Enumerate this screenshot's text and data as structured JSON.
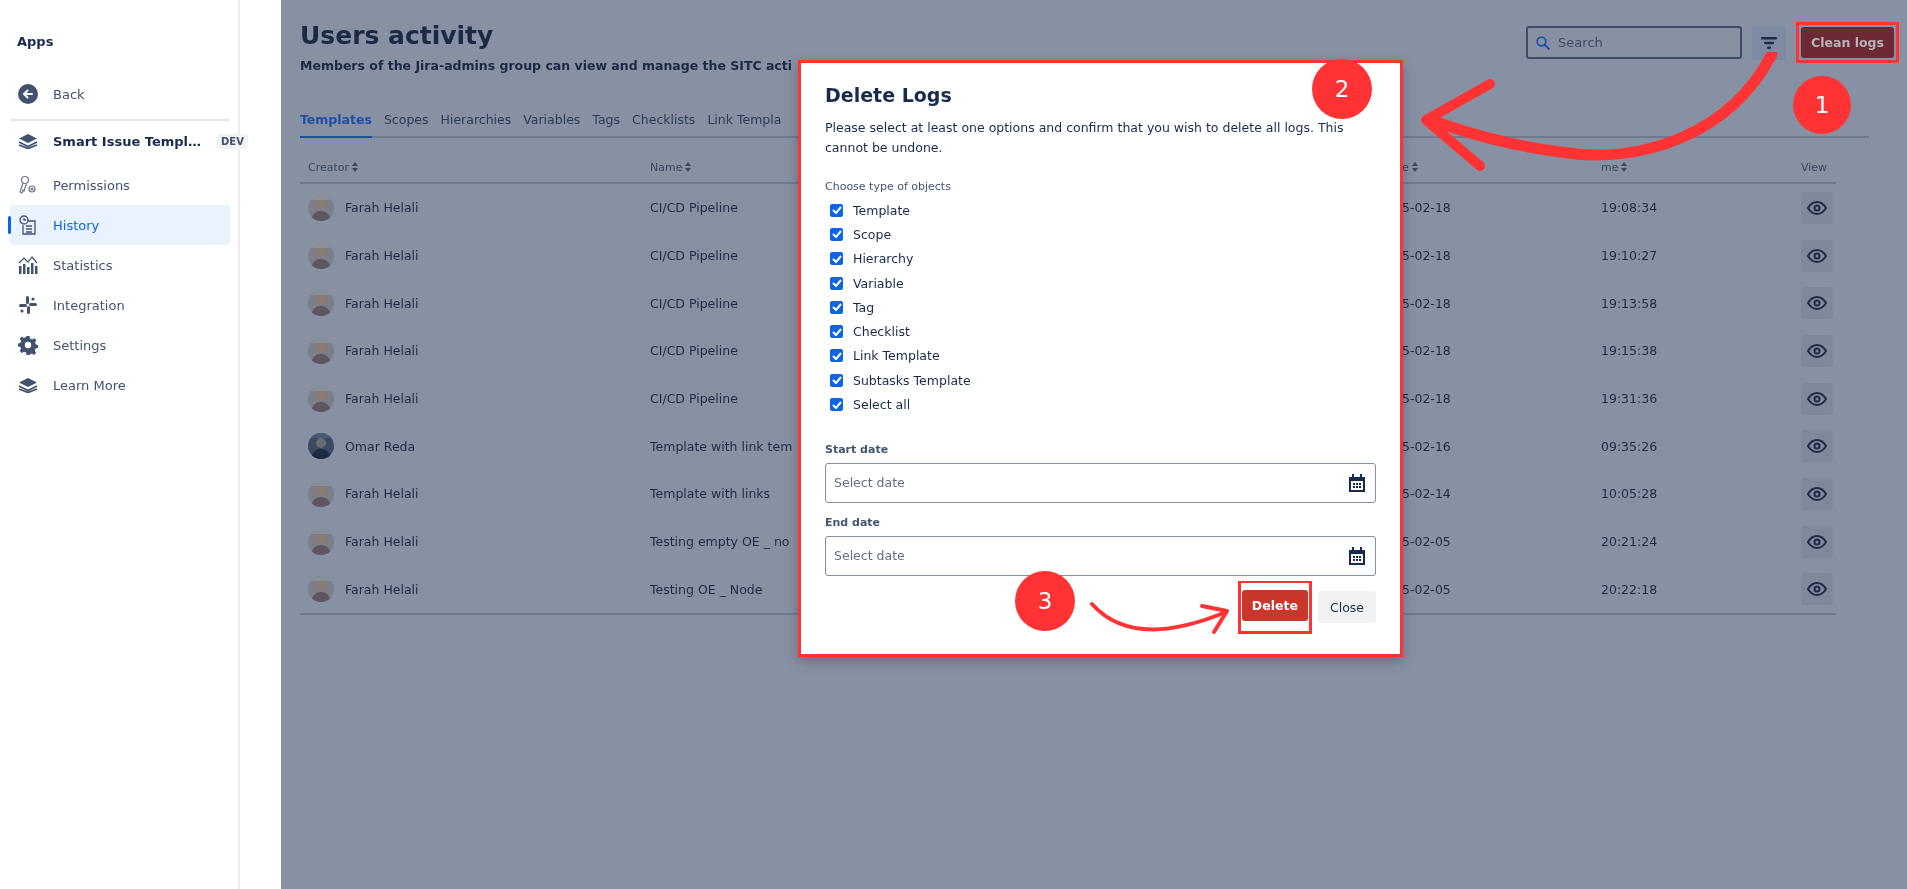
{
  "sidebar": {
    "heading": "Apps",
    "back": "Back",
    "app": {
      "name": "Smart Issue Templ…",
      "badge": "DEV"
    },
    "items": [
      {
        "label": "Permissions",
        "selected": false
      },
      {
        "label": "History",
        "selected": true
      },
      {
        "label": "Statistics",
        "selected": false
      },
      {
        "label": "Integration",
        "selected": false
      },
      {
        "label": "Settings",
        "selected": false
      },
      {
        "label": "Learn More",
        "selected": false
      }
    ]
  },
  "header": {
    "title": "Users activity",
    "subtitle": "Members of the Jira-admins group can view and manage the SITC acti",
    "search": {
      "placeholder": "Search"
    },
    "clean_button": {
      "label": "Clean logs",
      "highlighted": true
    }
  },
  "tabs": [
    {
      "label": "Templates",
      "selected": true
    },
    {
      "label": "Scopes",
      "selected": false
    },
    {
      "label": "Hierarchies",
      "selected": false
    },
    {
      "label": "Variables",
      "selected": false
    },
    {
      "label": "Tags",
      "selected": false
    },
    {
      "label": "Checklists",
      "selected": false
    },
    {
      "label": "Link Templa",
      "selected": false
    }
  ],
  "table": {
    "columns": [
      {
        "label": "Creator",
        "sortable": true
      },
      {
        "label": "Name",
        "sortable": true
      },
      {
        "label": "e",
        "sortable": true
      },
      {
        "label": "me",
        "sortable": true
      },
      {
        "label": "View",
        "sortable": false
      }
    ],
    "rows": [
      {
        "creator": "Farah Helali",
        "name": "CI/CD Pipeline",
        "date": "5-02-18",
        "time": "19:08:34"
      },
      {
        "creator": "Farah Helali",
        "name": "CI/CD Pipeline",
        "date": "5-02-18",
        "time": "19:10:27"
      },
      {
        "creator": "Farah Helali",
        "name": "CI/CD Pipeline",
        "date": "5-02-18",
        "time": "19:13:58"
      },
      {
        "creator": "Farah Helali",
        "name": "CI/CD Pipeline",
        "date": "5-02-18",
        "time": "19:15:38"
      },
      {
        "creator": "Farah Helali",
        "name": "CI/CD Pipeline",
        "date": "5-02-18",
        "time": "19:31:36"
      },
      {
        "creator": "Omar Reda",
        "name": "Template with link tem",
        "date": "5-02-16",
        "time": "09:35:26"
      },
      {
        "creator": "Farah Helali",
        "name": "Template with links",
        "date": "5-02-14",
        "time": "10:05:28"
      },
      {
        "creator": "Farah Helali",
        "name": "Testing empty OE _ no",
        "date": "5-02-05",
        "time": "20:21:24"
      },
      {
        "creator": "Farah Helali",
        "name": "Testing OE _ Node",
        "date": "5-02-05",
        "time": "20:22:18"
      }
    ]
  },
  "dialog": {
    "title": "Delete Logs",
    "highlighted": true,
    "message": "Please select at least one options and confirm that you wish to delete all logs. This cannot be undone.",
    "group_label": "Choose type of objects",
    "options": [
      {
        "label": "Template",
        "checked": true
      },
      {
        "label": "Scope",
        "checked": true
      },
      {
        "label": "Hierarchy",
        "checked": true
      },
      {
        "label": "Variable",
        "checked": true
      },
      {
        "label": "Tag",
        "checked": true
      },
      {
        "label": "Checklist",
        "checked": true
      },
      {
        "label": "Link Template",
        "checked": true
      },
      {
        "label": "Subtasks Template",
        "checked": true
      },
      {
        "label": "Select all",
        "checked": true
      }
    ],
    "start_date": {
      "label": "Start date",
      "placeholder": "Select date"
    },
    "end_date": {
      "label": "End date",
      "placeholder": "Select date"
    },
    "delete_button": {
      "label": "Delete",
      "highlighted": true
    },
    "close_button": {
      "label": "Close"
    }
  },
  "annotations": [
    {
      "label": "1"
    },
    {
      "label": "2"
    },
    {
      "label": "3"
    }
  ]
}
